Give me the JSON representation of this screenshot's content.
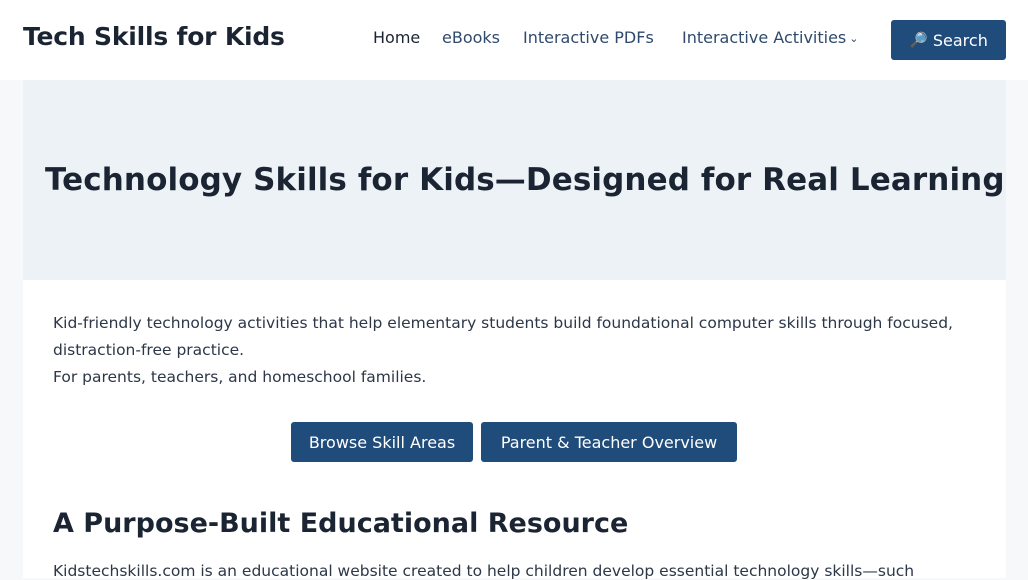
{
  "header": {
    "site_title": "Tech Skills for Kids",
    "nav": [
      {
        "label": "Home",
        "active": true
      },
      {
        "label": "eBooks"
      },
      {
        "label": "Interactive PDFs"
      },
      {
        "label": "Interactive Activities",
        "has_dropdown": true
      }
    ],
    "dropdown_icon": "chevron-down-icon",
    "search": {
      "icon": "magnifier-icon",
      "label": "Search"
    }
  },
  "hero": {
    "title": "Technology Skills for Kids—Designed for Real Learning"
  },
  "main": {
    "intro_line1": "Kid-friendly technology activities that help elementary students build foundational computer skills through focused, distraction-free practice.",
    "intro_line2": "For parents, teachers, and homeschool families.",
    "buttons": [
      {
        "label": "Browse Skill Areas"
      },
      {
        "label": "Parent & Teacher Overview"
      }
    ],
    "section_title": "A Purpose-Built Educational Resource",
    "section_text": "Kidstechskills.com is an educational website created to help children develop essential technology skills—such"
  },
  "colors": {
    "accent": "#204c7b",
    "hero_bg": "#edf2f7",
    "text": "#1b2432"
  }
}
